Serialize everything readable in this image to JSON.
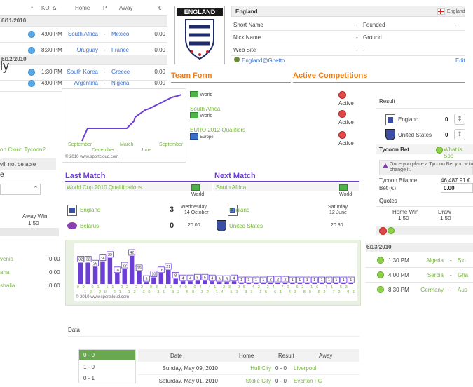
{
  "fixtures": {
    "columns": {
      "sort": "*",
      "ko": "KO",
      "delta": "Δ",
      "home": "Home",
      "p": "P",
      "away": "Away",
      "euro": "€"
    },
    "groups": [
      {
        "date": "6/11/2010",
        "rows": [
          {
            "ko": "4:00 PM",
            "home": "South Africa",
            "sep": "-",
            "away": "Mexico",
            "val": "0.00"
          },
          {
            "ko": "8:30 PM",
            "home": "Uruguay",
            "sep": "-",
            "away": "France",
            "val": "0.00"
          }
        ]
      },
      {
        "date": "6/12/2010",
        "rows": [
          {
            "ko": "1:30 PM",
            "home": "South Korea",
            "sep": "-",
            "away": "Greece",
            "val": "0.00"
          },
          {
            "ko": "4:00 PM",
            "home": "Argentina",
            "sep": "-",
            "away": "Nigeria",
            "val": "0.00"
          }
        ]
      }
    ]
  },
  "left_clipped": {
    "ly": "ly",
    "tycoon_q": "ort Cloud Tycoon?",
    "note": "vill not be able",
    "e": "e",
    "away_win": "Away Win",
    "away_win_val": "1.50",
    "teams": [
      {
        "name": "venia",
        "val": "0.00"
      },
      {
        "name": "ana",
        "val": "0.00"
      },
      {
        "name": "stralia",
        "val": "0.00"
      }
    ]
  },
  "team": {
    "badge_title": "ENGLAND",
    "name": "England",
    "flag_label": "England",
    "fields": [
      {
        "label": "Short Name",
        "sep": "-",
        "label2": "Founded",
        "val2": "-"
      },
      {
        "label": "Nick Name",
        "sep": "-",
        "label2": "Ground",
        "val2": ""
      },
      {
        "label": "Web Site",
        "sep": "-",
        "label2": "-",
        "val2": ""
      }
    ],
    "email": "England@Ghetto",
    "edit": "Edit"
  },
  "team_form": {
    "title": "Team Form",
    "x_labels_top": [
      "September",
      "March",
      "September"
    ],
    "x_labels_bottom": [
      "December",
      "June"
    ],
    "credit": "© 2010 www.sportcloud.com"
  },
  "active_competitions": {
    "title": "Active Competitions",
    "items": [
      {
        "name": "",
        "region": "World",
        "status": "Active"
      },
      {
        "name": "South Africa",
        "region": "World",
        "status": "Active"
      },
      {
        "name": "EURO 2012 Qualifiers",
        "region": "Europe",
        "status": "Active"
      }
    ]
  },
  "last_match": {
    "title": "Last Match",
    "competition": "World Cup 2010 Qualifications",
    "region": "World",
    "home": "England",
    "home_score": "3",
    "away": "Belarus",
    "away_score": "0",
    "date_day": "Wednesday",
    "date": "14 October",
    "time": "20:00"
  },
  "next_match": {
    "title": "Next Match",
    "competition": "South Africa",
    "region": "World",
    "home": "England",
    "away": "United States",
    "date_day": "Saturday",
    "date": "12 June",
    "time": "20:30"
  },
  "result_panel": {
    "title": "Result",
    "home": "England",
    "home_val": "0",
    "away": "United States",
    "away_val": "0",
    "tycoon_bet": "Tycoon Bet",
    "what_is": "What is Spo",
    "notice": "Once you place a Tycoon Bet you w to change it.",
    "bilance_label": "Tycoon Bilance",
    "bilance_val": "46,487.91 €",
    "bet_label": "Bet (€)",
    "bet_val": "0.00",
    "quotes": "Quotes",
    "home_win": "Home Win",
    "draw": "Draw",
    "home_win_val": "1.50",
    "draw_val": "1.50"
  },
  "right_fixtures": {
    "date": "6/13/2010",
    "rows": [
      {
        "ko": "1:30 PM",
        "home": "Algeria",
        "sep": "-",
        "away": "Slo"
      },
      {
        "ko": "4:00 PM",
        "home": "Serbia",
        "sep": "-",
        "away": "Gha"
      },
      {
        "ko": "8:30 PM",
        "home": "Germany",
        "sep": "-",
        "away": "Aus"
      }
    ]
  },
  "chart_data": {
    "type": "bar",
    "categories": [
      "0 - 0",
      "1 - 0",
      "0 - 1",
      "2 - 0",
      "1 - 1",
      "2 - 1",
      "0 - 2",
      "1 - 2",
      "2 - 2",
      "3 - 0",
      "0 - 3",
      "3 - 1",
      "1 - 3",
      "3 - 2",
      "4 - 0",
      "5 - 0",
      "0 - 4",
      "3 - 2",
      "4 - 1",
      "1 - 4",
      "2 - 3",
      "5 - 1",
      "0 - 5",
      "3 - 3",
      "4 - 2",
      "1 - 5",
      "2 - 4",
      "6 - 1",
      "7 - 0",
      "4 - 3",
      "5 - 2",
      "8 - 0",
      "1 - 6",
      "6 - 2",
      "7 - 1",
      "7 - 2",
      "5 - 3",
      "9 - 1"
    ],
    "values": [
      32,
      32,
      26,
      34,
      39,
      16,
      23,
      42,
      19,
      3,
      10,
      16,
      21,
      8,
      4,
      4,
      5,
      5,
      4,
      3,
      3,
      4,
      1,
      1,
      1,
      1,
      2,
      2,
      2,
      1,
      1,
      1,
      1,
      1,
      1,
      1,
      1,
      1
    ],
    "credit": "© 2010 www.sportcloud.com",
    "color": "#6b3fd6"
  },
  "data_section": {
    "title": "Data",
    "filter_items": [
      "0 - 0",
      "1 - 0",
      "0 - 1"
    ],
    "columns": {
      "date": "Date",
      "home": "Home",
      "result": "Result",
      "away": "Away"
    },
    "rows": [
      {
        "date": "Sunday, May 09, 2010",
        "home": "Hull City",
        "result": "0 - 0",
        "away": "Liverpool"
      },
      {
        "date": "Saturday, May 01, 2010",
        "home": "Stoke City",
        "result": "0 - 0",
        "away": "Everton FC"
      }
    ]
  }
}
